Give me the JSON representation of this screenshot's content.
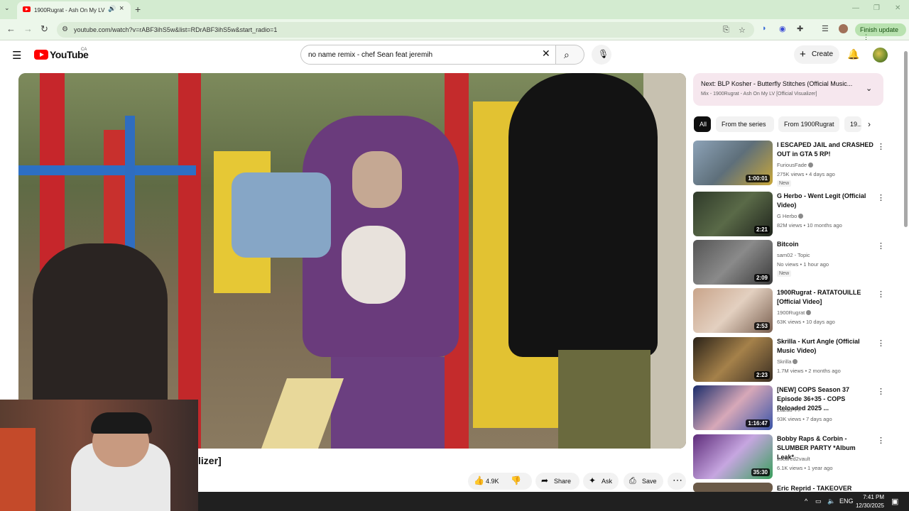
{
  "browser": {
    "tab_title": "1900Rugrat - Ash On My LV",
    "url": "youtube.com/watch?v=rABF3ihS5w&list=RDrABF3ihS5w&start_radio=1",
    "finish_update": "Finish update"
  },
  "masthead": {
    "logo_text": "YouTube",
    "country": "CA",
    "search_value": "no name remix - chef Sean feat jeremih",
    "create_label": "Create"
  },
  "video": {
    "title_fragment": "lizer]",
    "like_count": "4.9K",
    "share_label": "Share",
    "ask_label": "Ask",
    "save_label": "Save"
  },
  "up_next": {
    "line1": "Next: BLP Kosher - Butterfly Stitches (Official Music...",
    "line2": "Mix - 1900Rugrat - Ash On My LV [Official Visualizer]"
  },
  "chips": [
    "All",
    "From the series",
    "From 1900Rugrat",
    "19..."
  ],
  "recommendations": [
    {
      "title": "I ESCAPED JAIL and CRASHED OUT in GTA 5 RP!",
      "channel": "FuriousFade",
      "verified": true,
      "stats": "275K views • 4 days ago",
      "badge": "New",
      "duration": "1:00:01"
    },
    {
      "title": "G Herbo - Went Legit (Official Video)",
      "channel": "G Herbo",
      "verified": true,
      "stats": "82M views • 10 months ago",
      "badge": "",
      "duration": "2:21"
    },
    {
      "title": "Bitcoin",
      "channel": "sam02 - Topic",
      "verified": false,
      "stats": "No views • 1 hour ago",
      "badge": "New",
      "duration": "2:09"
    },
    {
      "title": "1900Rugrat - RATATOUILLE [Official Video]",
      "channel": "1900Rugrat",
      "verified": true,
      "stats": "63K views • 10 days ago",
      "badge": "",
      "duration": "2:53"
    },
    {
      "title": "Skrilla - Kurt Angle (Official Music Video)",
      "channel": "Skrilla",
      "verified": true,
      "stats": "1.7M views • 2 months ago",
      "badge": "",
      "duration": "2:23"
    },
    {
      "title": "[NEW] COPS Season 37 Episode 36+35 - COPS Reloaded 2025 ...",
      "channel": "ZaZau YT",
      "verified": false,
      "stats": "93K views • 7 days ago",
      "badge": "",
      "duration": "1:16:47"
    },
    {
      "title": "Bobby Raps & Corbin - SLUMBER PARTY *Album Leak*",
      "channel": "2scared2vault",
      "verified": false,
      "stats": "6.1K views • 1 year ago",
      "badge": "",
      "duration": "35:30"
    },
    {
      "title": "Eric Reprid - TAKEOVER",
      "channel": "",
      "verified": false,
      "stats": "",
      "badge": "",
      "duration": ""
    }
  ],
  "taskbar": {
    "lang": "ENG",
    "time": "7:41 PM",
    "date": "12/30/2025"
  }
}
